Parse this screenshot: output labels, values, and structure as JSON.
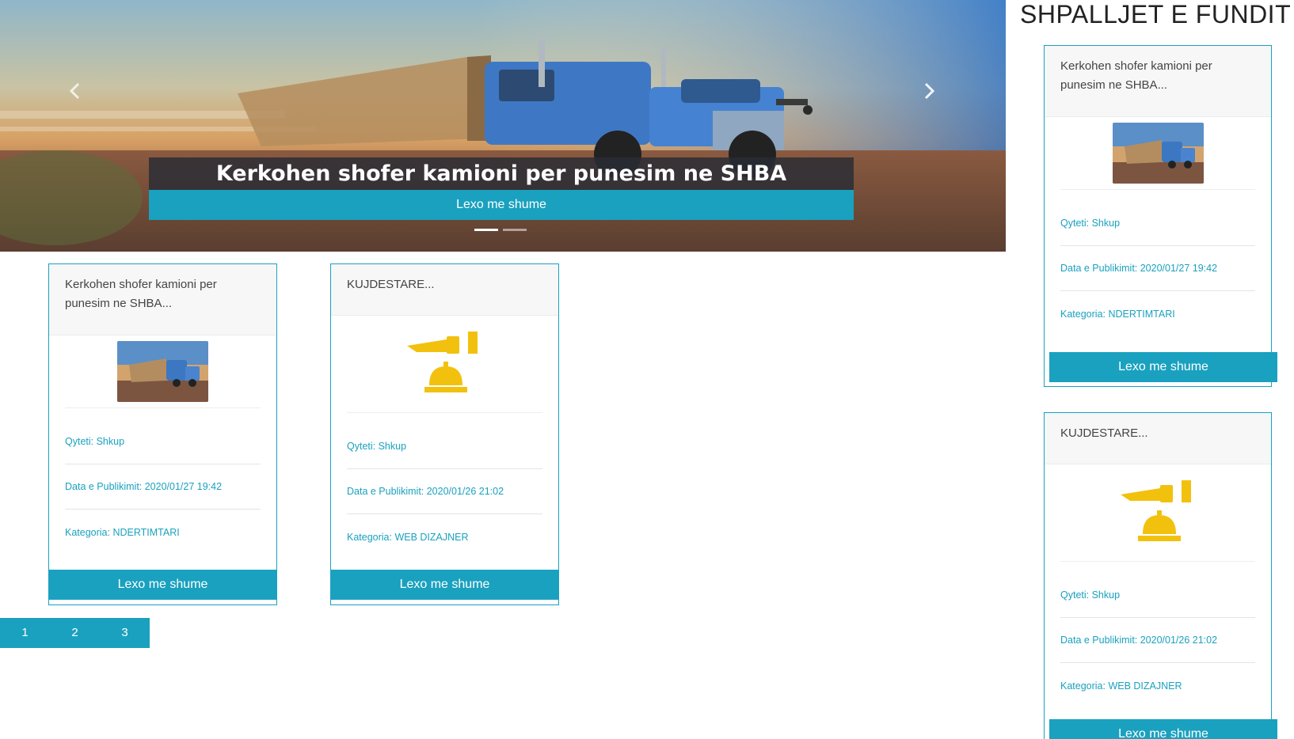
{
  "carousel": {
    "caption": "Kerkohen shofer kamioni per punesim ne SHBA",
    "button_label": "Lexo me shume",
    "prev_glyph": "‹",
    "next_glyph": "›"
  },
  "listings": [
    {
      "title": "Kerkohen shofer kamioni per punesim ne SHBA...",
      "image": "truck-image",
      "city": "Qyteti: Shkup",
      "date": "Data e Publikimit: 2020/01/27 19:42",
      "category": "Kategoria: NDERTIMTARI",
      "button_label": "Lexo me shume"
    },
    {
      "title": "KUJDESTARE...",
      "image": "hotel-bell-icon",
      "city": "Qyteti: Shkup",
      "date": "Data e Publikimit: 2020/01/26 21:02",
      "category": "Kategoria: WEB DIZAJNER",
      "button_label": "Lexo me shume"
    }
  ],
  "pagination": {
    "pages": [
      "1",
      "2",
      "3"
    ]
  },
  "sidebar": {
    "title": "SHPALLJET E FUNDIT",
    "items": [
      {
        "title": "Kerkohen shofer kamioni per punesim ne SHBA...",
        "image": "truck-image",
        "city": "Qyteti: Shkup",
        "date": "Data e Publikimit: 2020/01/27 19:42",
        "category": "Kategoria: NDERTIMTARI",
        "button_label": "Lexo me shume"
      },
      {
        "title": "KUJDESTARE...",
        "image": "hotel-bell-icon",
        "city": "Qyteti: Shkup",
        "date": "Data e Publikimit: 2020/01/26 21:02",
        "category": "Kategoria: WEB DIZAJNER",
        "button_label": "Lexo me shume"
      }
    ]
  },
  "colors": {
    "accent": "#1aa1bf",
    "bell": "#f2c10e"
  }
}
